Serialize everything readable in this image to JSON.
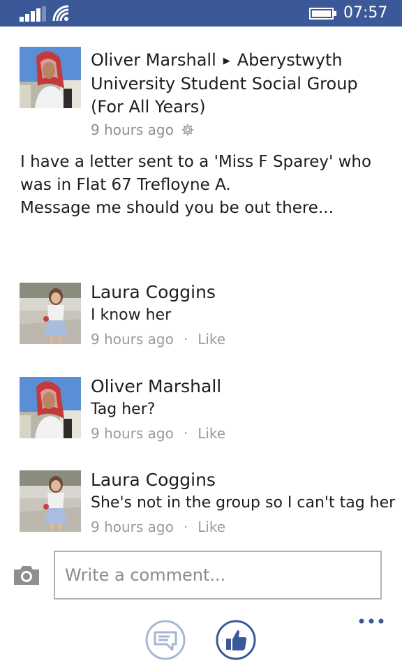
{
  "status_bar": {
    "time": "07:57",
    "bar_color": "#3b5998",
    "icons": [
      "signal-icon",
      "wifi-icon",
      "battery-icon"
    ]
  },
  "post": {
    "author": "Oliver Marshall",
    "group": "Aberystwyth University Student Social Group (For All Years)",
    "time": "9 hours ago",
    "body_lines": [
      "I have a letter sent to a 'Miss F Sparey' who",
      "was in Flat 67 Trefloyne A.",
      "Message me should you be out there..."
    ]
  },
  "comments": [
    {
      "name": "Laura Coggins",
      "text": "I know her",
      "time": "9 hours ago",
      "separator": "·",
      "like": "Like"
    },
    {
      "name": "Oliver Marshall",
      "text": "Tag her?",
      "time": "9 hours ago",
      "separator": "·",
      "like": "Like"
    },
    {
      "name": "Laura Coggins",
      "text": "She's not in the group so I can't tag her",
      "time": "9 hours ago",
      "separator": "·",
      "like": "Like"
    }
  ],
  "composer": {
    "placeholder": "Write a comment..."
  },
  "app_bar": {
    "buttons": [
      "comment-bubble-icon",
      "thumbs-up-icon"
    ],
    "more_icon": "more-ellipsis-icon",
    "accent": "#3b5998"
  }
}
